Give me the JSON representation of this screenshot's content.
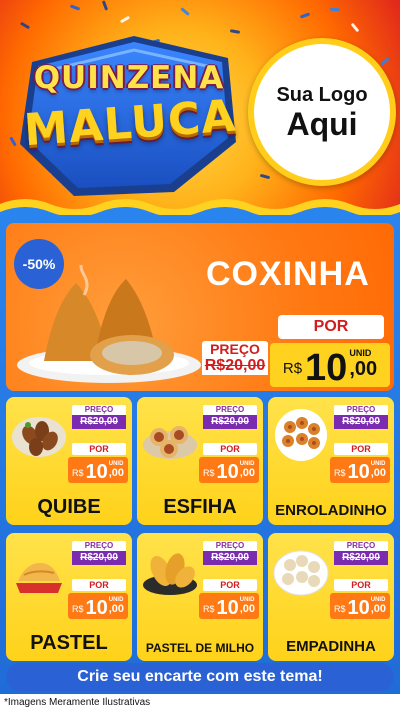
{
  "header": {
    "title_line1": "QUINZENA",
    "title_line2": "MALUCA",
    "logo_line1": "Sua Logo",
    "logo_line2": "Aqui"
  },
  "featured": {
    "discount": "-50%",
    "name": "COXINHA",
    "price_label": "PREÇO",
    "old_price": "R$20,00",
    "por_label": "POR",
    "currency": "R$",
    "price_int": "10",
    "price_dec": ",00",
    "unit": "UNID",
    "image_icon": "coxinha-food-icon"
  },
  "products": [
    {
      "name": "QUIBE",
      "price_label": "PREÇO",
      "old_price": "R$20,00",
      "por_label": "POR",
      "currency": "R$",
      "price_int": "10",
      "price_dec": ",00",
      "unit": "UNID",
      "image_icon": "quibe-food-icon"
    },
    {
      "name": "ESFIHA",
      "price_label": "PREÇO",
      "old_price": "R$20,00",
      "por_label": "POR",
      "currency": "R$",
      "price_int": "10",
      "price_dec": ",00",
      "unit": "UNID",
      "image_icon": "esfiha-food-icon"
    },
    {
      "name": "ENROLADINHO",
      "price_label": "PREÇO",
      "old_price": "R$20,00",
      "por_label": "POR",
      "currency": "R$",
      "price_int": "10",
      "price_dec": ",00",
      "unit": "UNID",
      "image_icon": "enroladinho-food-icon"
    },
    {
      "name": "PASTEL",
      "price_label": "PREÇO",
      "old_price": "R$20,00",
      "por_label": "POR",
      "currency": "R$",
      "price_int": "10",
      "price_dec": ",00",
      "unit": "UNID",
      "image_icon": "pastel-food-icon"
    },
    {
      "name": "PASTEL DE MILHO",
      "price_label": "PREÇO",
      "old_price": "R$20,00",
      "por_label": "POR",
      "currency": "R$",
      "price_int": "10",
      "price_dec": ",00",
      "unit": "UNID",
      "image_icon": "pastel-de-milho-food-icon"
    },
    {
      "name": "EMPADINHA",
      "price_label": "PREÇO",
      "old_price": "R$20,00",
      "por_label": "POR",
      "currency": "R$",
      "price_int": "10",
      "price_dec": ",00",
      "unit": "UNID",
      "image_icon": "empadinha-food-icon"
    }
  ],
  "cta": "Crie seu encarte com este tema!",
  "footer_note": "*Imagens Meramente Ilustrativas",
  "colors": {
    "primary_blue": "#2a62d6",
    "yellow": "#ffd21f",
    "orange": "#ff7a14",
    "red": "#d11d1d",
    "purple": "#7a2bb0"
  }
}
